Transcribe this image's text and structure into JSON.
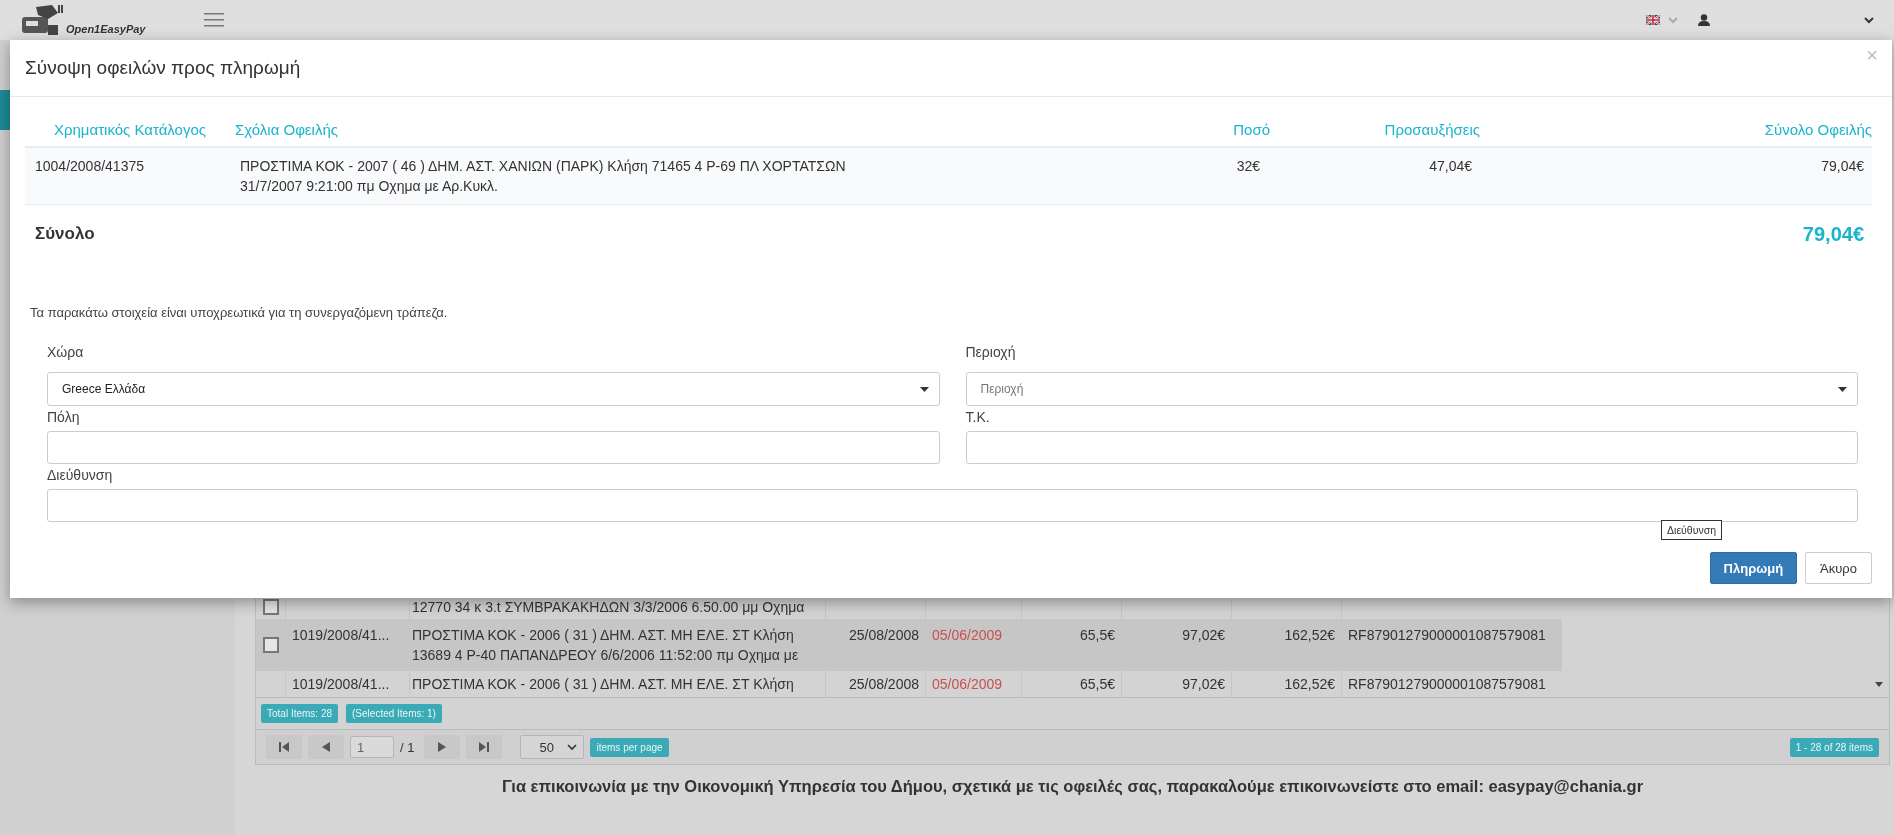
{
  "header": {
    "logo_text": "Open1EasyPay"
  },
  "sidebar": {
    "items": [
      {
        "selected": true
      }
    ]
  },
  "grid": {
    "rows": [
      {
        "checked": false,
        "catalog": "",
        "comments": "12770 34 κ 3.t ΣΥΜΒΡΑΚΑΚΗΔΩΝ 3/3/2006 6.50.00 μμ Οχημα",
        "issued": "",
        "due": "",
        "amount": "",
        "increase": "",
        "total": "",
        "code": "",
        "selected": false
      },
      {
        "checked": false,
        "catalog": "1019/2008/41...",
        "comments": "ΠΡΟΣΤΙΜΑ ΚΟΚ - 2006 ( 31 ) ΔΗΜ. ΑΣΤ. ΜΗ ΕΛΕ. ΣΤ Κλήση 13689 4 Ρ-40 ΠΑΠΑΝΔΡΕΟΥ 6/6/2006 11:52:00 πμ Οχημα με",
        "issued": "25/08/2008",
        "due": "05/06/2009",
        "amount": "65,5€",
        "increase": "97,02€",
        "total": "162,52€",
        "code": "RF87901279000001087579081",
        "selected": true
      },
      {
        "catalog": "1019/2008/41...",
        "comments": "ΠΡΟΣΤΙΜΑ ΚΟΚ - 2006 ( 31 ) ΔΗΜ. ΑΣΤ. ΜΗ ΕΛΕ. ΣΤ Κλήση",
        "issued": "25/08/2008",
        "due": "05/06/2009",
        "amount": "65,5€",
        "increase": "97,02€",
        "total": "162,52€",
        "code": "RF87901279000001087579081",
        "selected": false
      }
    ],
    "total_items": "Total Items: 28",
    "selected_items": "(Selected Items: 1)",
    "pager": {
      "page": "1",
      "of": "/ 1",
      "page_size": "50",
      "per_page": "items per page",
      "range": "1 - 28 of 28 items"
    }
  },
  "footer": "Για επικοινωνία με την Οικονομική Υπηρεσία του Δήμου, σχετικά με τις οφειλές σας, παρακαλούμε επικοινωνείστε στο email: easypay@chania.gr",
  "modal": {
    "title": "Σύνοψη οφειλών προς πληρωμή",
    "close": "×",
    "table": {
      "columns": [
        "Χρηματικός Κατάλογος",
        "Σχόλια Οφειλής",
        "Ποσό",
        "Προσαυξήσεις",
        "Σύνολο Οφειλής"
      ],
      "rows": [
        {
          "catalog": "1004/2008/41375",
          "comments": "ΠΡΟΣΤΙΜΑ ΚΟΚ - 2007 ( 46 ) ΔΗΜ. ΑΣΤ. ΧΑΝΙΩΝ (ΠΑΡΚ) Κλήση 71465 4 Ρ-69 ΠΛ ΧΟΡΤΑΤΣΩΝ 31/7/2007 9:21:00 πμ Οχημα με Αρ.Κυκλ.",
          "amount": "32€",
          "increase": "47,04€",
          "total": "79,04€"
        }
      ]
    },
    "total_label": "Σύνολο",
    "total_value": "79,04€",
    "note": "Τα παρακάτω στοιχεία είναι υποχρεωτικά για τη συνεργαζόμενη τράπεζα.",
    "fields": [
      {
        "label": "Χώρα",
        "kind": "select",
        "value": "Greece Ελλάδα",
        "full_width": false
      },
      {
        "label": "Περιοχή",
        "kind": "select",
        "placeholder": "Περιοχή",
        "full_width": false
      },
      {
        "label": "Πόλη",
        "kind": "text",
        "full_width": false
      },
      {
        "label": "Τ.Κ.",
        "kind": "text",
        "full_width": false
      },
      {
        "label": "Διεύθυνση",
        "kind": "text",
        "full_width": true
      }
    ],
    "tooltip": "Διεύθυνση",
    "buttons": [
      {
        "label": "Πληρωμή",
        "kind": "primary"
      },
      {
        "label": "Άκυρο",
        "kind": "default"
      }
    ]
  }
}
